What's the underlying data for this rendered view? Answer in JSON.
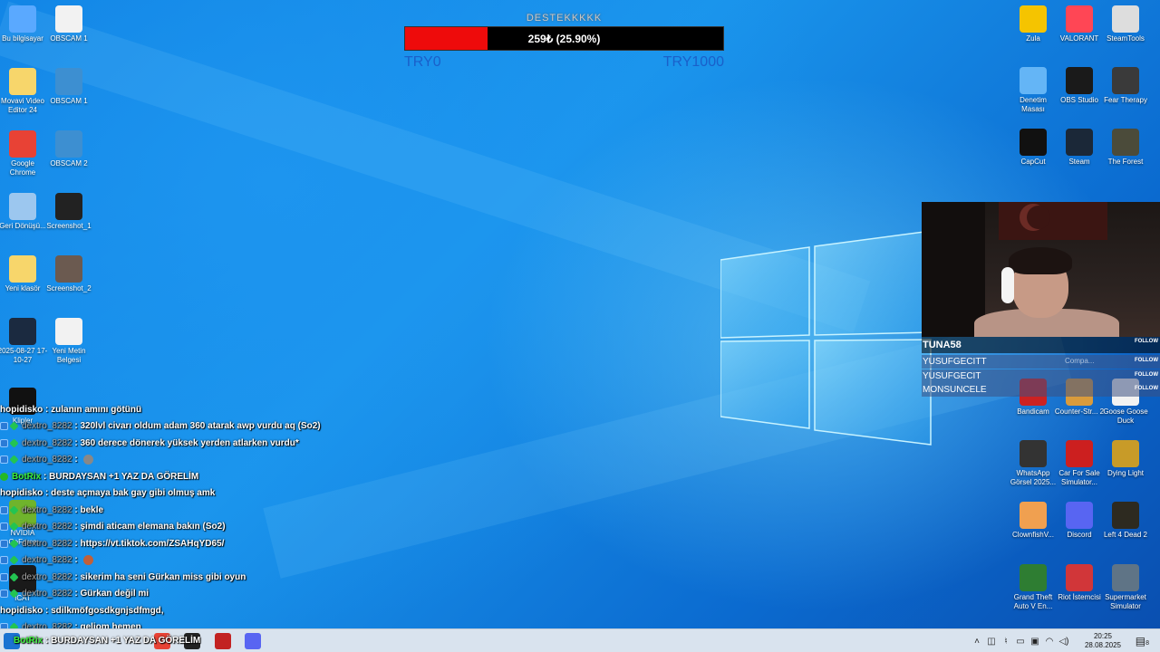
{
  "donation": {
    "title": "DESTEKKKKK",
    "amount_text": "259₺ (25.90%)",
    "progress_fraction": 0.259,
    "min_label": "TRY0",
    "max_label": "TRY1000"
  },
  "desktop_left": [
    {
      "label": "Bu bilgisayar",
      "icon": "computer-icon",
      "color": "#5aa9ff"
    },
    {
      "label": "OBSCAM 1",
      "icon": "text-file-icon",
      "color": "#f2f2f2"
    },
    {
      "label": "Movavi Video Editor 24",
      "icon": "folder-icon",
      "color": "#f7d66b"
    },
    {
      "label": "OBSCAM 1",
      "icon": "obs-doc-icon",
      "color": "#3d8fd1"
    },
    {
      "label": "Google Chrome",
      "icon": "chrome-icon",
      "color": "#e84235"
    },
    {
      "label": "OBSCAM 2",
      "icon": "obs-doc-icon",
      "color": "#3d8fd1"
    },
    {
      "label": "Geri Dönüşü...",
      "icon": "recycle-bin-icon",
      "color": "#9cc7ef"
    },
    {
      "label": "Screenshot_1",
      "icon": "image-icon",
      "color": "#222222"
    },
    {
      "label": "Yeni klasör",
      "icon": "folder-icon",
      "color": "#f7d66b"
    },
    {
      "label": "Screenshot_2",
      "icon": "image-icon",
      "color": "#6b5a50"
    },
    {
      "label": "2025-08-27 17-10-27",
      "icon": "video-icon",
      "color": "#1b2a40"
    },
    {
      "label": "Yeni Metin Belgesi",
      "icon": "text-file-icon",
      "color": "#f2f2f2"
    }
  ],
  "desktop_left_partial": [
    {
      "label": "Klipler",
      "icon": "video-icon",
      "color": "#111111"
    },
    {
      "label": "NVIDIA GeForce",
      "icon": "nvidia-icon",
      "color": "#6fb42c"
    },
    {
      "label": "ICAT",
      "icon": "nvidia-icon",
      "color": "#1a1a1a"
    }
  ],
  "desktop_right": [
    {
      "label": "Zula",
      "icon": "zula-icon",
      "color": "#f5c400"
    },
    {
      "label": "VALORANT",
      "icon": "valorant-icon",
      "color": "#ff4655"
    },
    {
      "label": "SteamTools",
      "icon": "steamtools-icon",
      "color": "#dddddd"
    },
    {
      "label": "Denetim Masası",
      "icon": "control-panel-icon",
      "color": "#64b5f6"
    },
    {
      "label": "OBS Studio",
      "icon": "obs-icon",
      "color": "#1a1a1a"
    },
    {
      "label": "Fear Therapy",
      "icon": "game-icon",
      "color": "#3a3a3a"
    },
    {
      "label": "CapCut",
      "icon": "capcut-icon",
      "color": "#111111"
    },
    {
      "label": "Steam",
      "icon": "steam-icon",
      "color": "#1b2838"
    },
    {
      "label": "The Forest",
      "icon": "game-icon",
      "color": "#4b4b3a"
    },
    {
      "label": "Bandicam",
      "icon": "bandicam-icon",
      "color": "#c22"
    },
    {
      "label": "Counter-Str... 2",
      "icon": "cs2-icon",
      "color": "#d99b3c"
    },
    {
      "label": "Goose Goose Duck",
      "icon": "game-icon",
      "color": "#f2f2f2"
    },
    {
      "label": "WhatsApp Görsel 2025...",
      "icon": "image-icon",
      "color": "#333333"
    },
    {
      "label": "Car For Sale Simulator...",
      "icon": "cfs-icon",
      "color": "#cc1f1f"
    },
    {
      "label": "Dying Light",
      "icon": "dying-light-icon",
      "color": "#c89b28"
    },
    {
      "label": "ClownfishV...",
      "icon": "clownfish-icon",
      "color": "#f0a050"
    },
    {
      "label": "Discord",
      "icon": "discord-icon",
      "color": "#5865f2"
    },
    {
      "label": "Left 4 Dead 2",
      "icon": "l4d2-icon",
      "color": "#2d2a20"
    },
    {
      "label": "Grand Theft Auto V En...",
      "icon": "gta-icon",
      "color": "#2e7d32"
    },
    {
      "label": "Riot İstemcisi",
      "icon": "riot-icon",
      "color": "#d13639"
    },
    {
      "label": "Supermarket Simulator",
      "icon": "game-icon",
      "color": "#5f7486"
    }
  ],
  "stream_overlay": {
    "streamer": "TUNA58",
    "follow_label": "FOLLOW",
    "faded_text": "Compa...",
    "followers": [
      "YUSUFGECITT",
      "YUSUFGECIT",
      "MONSUNCELE"
    ]
  },
  "chat": [
    {
      "user": "hopidisko",
      "style": "white",
      "badges": [],
      "message": "zulanın amını götünü"
    },
    {
      "user": "dextro_8282",
      "style": "grey",
      "badges": [
        "mod",
        "gem"
      ],
      "message": "320lvl civarı oldum adam 360 atarak awp vurdu aq (So2)"
    },
    {
      "user": "dextro_8282",
      "style": "grey",
      "badges": [
        "mod",
        "gem"
      ],
      "message": "360 derece dönerek yüksek yerden atlarken vurdu*"
    },
    {
      "user": "dextro_8282",
      "style": "grey",
      "badges": [
        "mod",
        "gem"
      ],
      "message": "",
      "emote": "#888888"
    },
    {
      "user": "BotRix",
      "style": "green",
      "badges": [
        "bot"
      ],
      "message": "BURDAYSAN +1 YAZ DA GÖRELİM"
    },
    {
      "user": "hopidisko",
      "style": "white",
      "badges": [],
      "message": "deste açmaya bak gay gibi olmuş amk"
    },
    {
      "user": "dextro_8282",
      "style": "grey",
      "badges": [
        "mod",
        "gem"
      ],
      "message": "bekle"
    },
    {
      "user": "dextro_8282",
      "style": "grey",
      "badges": [
        "mod",
        "gem"
      ],
      "message": "şimdi aticam elemana bakın (So2)"
    },
    {
      "user": "dextro_8282",
      "style": "grey",
      "badges": [
        "mod",
        "gem"
      ],
      "message": "https://vt.tiktok.com/ZSAHqYD65/"
    },
    {
      "user": "dextro_8282",
      "style": "grey",
      "badges": [
        "mod",
        "gem"
      ],
      "message": "",
      "emote": "#c0603a"
    },
    {
      "user": "dextro_8282",
      "style": "grey",
      "badges": [
        "mod",
        "gem"
      ],
      "message": "sikerim ha seni Gürkan miss gibi oyun"
    },
    {
      "user": "dextro_8282",
      "style": "grey",
      "badges": [
        "mod",
        "gem"
      ],
      "message": "Gürkan değil mi"
    },
    {
      "user": "hopidisko",
      "style": "white",
      "badges": [],
      "message": "sdilkmöfgosdkgnjsdfmgd,"
    },
    {
      "user": "dextro_8282",
      "style": "grey",
      "badges": [
        "mod",
        "gem"
      ],
      "message": "geliom hemen"
    }
  ],
  "taskbar": {
    "ticker_user": "BotRix",
    "ticker_message": "BURDAYSAN +1 YAZ DA GÖRELİM",
    "time": "20:25",
    "date": "28.08.2025",
    "notification_count": "8",
    "pinned": [
      {
        "icon": "windows-start-icon",
        "color": "#1a73d1"
      },
      {
        "icon": "chrome-taskbar-icon",
        "color": "#e84235"
      },
      {
        "icon": "obs-taskbar-icon",
        "color": "#222222"
      },
      {
        "icon": "bandicam-taskbar-icon",
        "color": "#c22222"
      },
      {
        "icon": "discord-taskbar-icon",
        "color": "#5865f2"
      }
    ]
  }
}
